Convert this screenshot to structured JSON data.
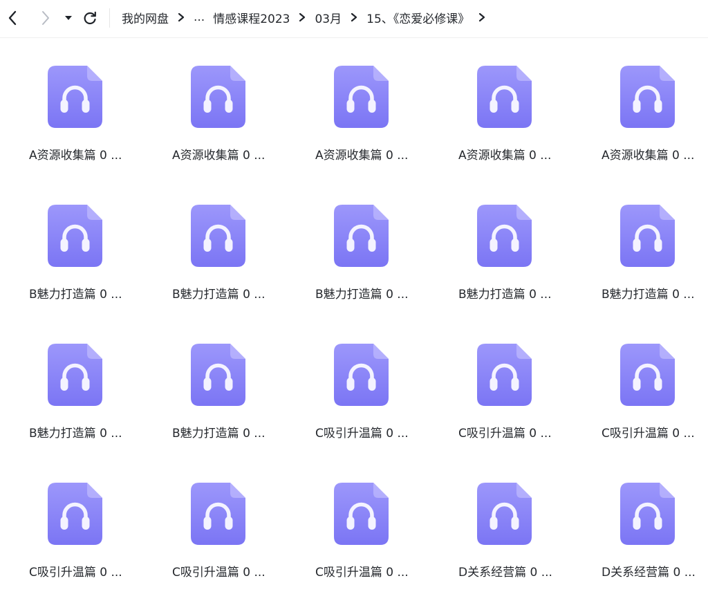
{
  "toolbar": {
    "back_icon": "chevron-left-icon",
    "forward_icon": "chevron-right-icon",
    "history_icon": "caret-down-icon",
    "refresh_icon": "refresh-icon"
  },
  "breadcrumb": {
    "items": [
      "我的网盘",
      "...",
      "情感课程2023",
      "03月",
      "15、《恋爱必修课》"
    ],
    "separator_icon": "chevron-right-icon"
  },
  "files": [
    {
      "name": "A资源收集篇 0 ...",
      "icon": "audio-file-icon"
    },
    {
      "name": "A资源收集篇 0 ...",
      "icon": "audio-file-icon"
    },
    {
      "name": "A资源收集篇 0 ...",
      "icon": "audio-file-icon"
    },
    {
      "name": "A资源收集篇 0 ...",
      "icon": "audio-file-icon"
    },
    {
      "name": "A资源收集篇 0 ...",
      "icon": "audio-file-icon"
    },
    {
      "name": "B魅力打造篇 0 ...",
      "icon": "audio-file-icon"
    },
    {
      "name": "B魅力打造篇 0 ...",
      "icon": "audio-file-icon"
    },
    {
      "name": "B魅力打造篇 0 ...",
      "icon": "audio-file-icon"
    },
    {
      "name": "B魅力打造篇 0 ...",
      "icon": "audio-file-icon"
    },
    {
      "name": "B魅力打造篇 0 ...",
      "icon": "audio-file-icon"
    },
    {
      "name": "B魅力打造篇 0 ...",
      "icon": "audio-file-icon"
    },
    {
      "name": "B魅力打造篇 0 ...",
      "icon": "audio-file-icon"
    },
    {
      "name": "C吸引升温篇 0 ...",
      "icon": "audio-file-icon"
    },
    {
      "name": "C吸引升温篇 0 ...",
      "icon": "audio-file-icon"
    },
    {
      "name": "C吸引升温篇 0 ...",
      "icon": "audio-file-icon"
    },
    {
      "name": "C吸引升温篇 0 ...",
      "icon": "audio-file-icon"
    },
    {
      "name": "C吸引升温篇 0 ...",
      "icon": "audio-file-icon"
    },
    {
      "name": "C吸引升温篇 0 ...",
      "icon": "audio-file-icon"
    },
    {
      "name": "D关系经营篇 0 ...",
      "icon": "audio-file-icon"
    },
    {
      "name": "D关系经营篇 0 ...",
      "icon": "audio-file-icon"
    }
  ],
  "colors": {
    "icon_top": "#9c97fb",
    "icon_bottom": "#7b75f4",
    "icon_fold": "#b8b4fd",
    "headphone": "#f4f3ff",
    "text": "#25282d",
    "disabled": "#b8bcc4"
  }
}
